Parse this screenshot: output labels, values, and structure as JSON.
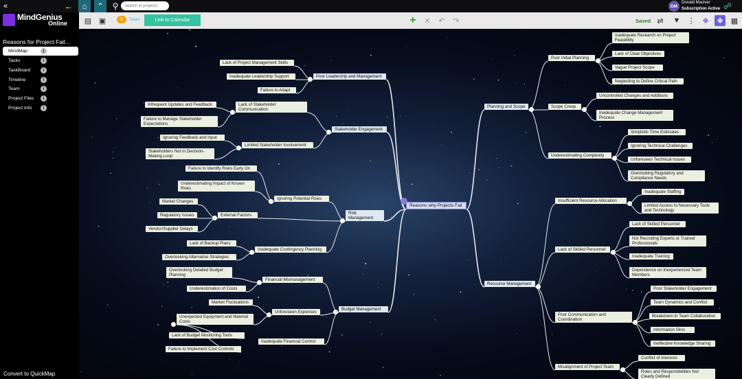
{
  "app": {
    "logo_main": "MindGenius",
    "logo_sub": "Online"
  },
  "search": {
    "placeholder": "Search in projects"
  },
  "user": {
    "initials": "DM",
    "name": "Donald Maciver",
    "subscription": "Subscription Active"
  },
  "sidebar": {
    "map_title": "Reasons for Project Fail...",
    "items": [
      {
        "label": "MindMap",
        "active": true
      },
      {
        "label": "Tasks"
      },
      {
        "label": "TaskBoard"
      },
      {
        "label": "Timeline"
      },
      {
        "label": "Team"
      },
      {
        "label": "Project Files"
      },
      {
        "label": "Project Info"
      }
    ],
    "info_glyph": "i",
    "quickmap_label": "Convert to QuickMap"
  },
  "toolbar": {
    "task_count": "0",
    "tasks_label": "Tasks",
    "calendar_button": "Link to Calendar",
    "saved_label": "Saved"
  },
  "mindmap": {
    "root": "Reasons why Projects Fail",
    "nodes": [
      "Poor Leadership and Management",
      "Lack of Project Management Skills",
      "Inadequate Leadership Support",
      "Failure to Adapt",
      "Stakeholder Engagement",
      "Lack of Stakeholder Communication",
      "Infrequent Updates and Feedback",
      "Failure to Manage Stakeholder Expectations",
      "Limited Stakeholder Involvement",
      "Ignoring Feedback and Input",
      "Stakeholders Not in Decision-Making Loop",
      "Risk Management",
      "Ignoring Potential Risks",
      "Failure to Identify Risks Early On",
      "Underestimating Impact of Known Risks",
      "External Factors",
      "Market Changes",
      "Regulatory Issues",
      "Vendor/Supplier Delays",
      "Inadequate Contingency Planning",
      "Lack of Backup Plans",
      "Overlooking Alternative Strategies",
      "Budget Management",
      "Financial Mismanagement",
      "Overlooking Detailed Budget Planning",
      "Underestimation of Costs",
      "Unforeseen Expenses",
      "Market Fluctuations",
      "Unexpected Equipment and Material Costs",
      "Inadequate Financial Control",
      "Lack of Budget Monitoring Tools",
      "Failure to Implement Cost Controls",
      "Planning and Scope",
      "Poor Initial Planning",
      "Inadequate Research on Project Feasibility",
      "Lack of Clear Objectives",
      "Vague Project Scope",
      "Neglecting to Define Critical Path",
      "Scope Creep",
      "Uncontrolled Changes and Additions",
      "Inadequate Change Management Process",
      "Underestimating Complexity",
      "Simplistic Time Estimates",
      "Ignoring Technical Challenges",
      "Unforeseen Technical Issues",
      "Overlooking Regulatory and Compliance Needs",
      "Resource Management",
      "Insufficient Resource Allocation",
      "Inadequate Staffing",
      "Limited Access to Necessary Tools and Technology",
      "Lack of Skilled Personnel",
      "Lack of Skilled Personnel",
      "Not Recruiting Experts or Trained Professionals",
      "Inadequate Training",
      "Dependence on Inexperienced Team Members",
      "Poor Communication and Coordination",
      "Poor Stakeholder Engagement",
      "Team Dynamics and Conflict",
      "Breakdown in Team Collaboration",
      "Information Silos",
      "Ineffective Knowledge Sharing",
      "Misalignment of Project Team",
      "Conflict of Interests",
      "Roles and Responsibilities Not Clearly Defined"
    ]
  },
  "icons": [
    "collapse-sidebar-icon",
    "back-arrow-icon",
    "home-icon",
    "up-level-icon",
    "search-icon",
    "integrations-icon",
    "notes-icon",
    "task-list-icon",
    "add-node-icon",
    "delete-node-icon",
    "undo-icon",
    "redo-icon",
    "layout-icon",
    "filter-icon",
    "more-icon",
    "branch-style-icon",
    "map-view-icon",
    "image-icon"
  ]
}
